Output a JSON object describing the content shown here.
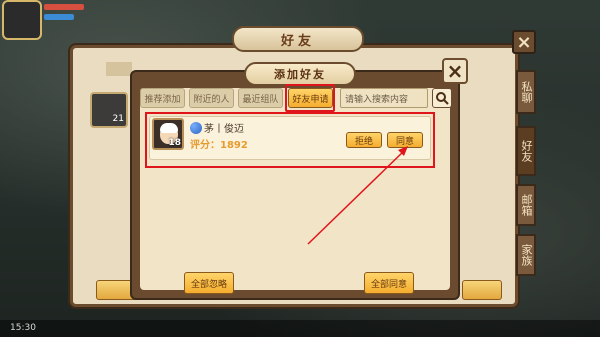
{
  "outer_panel": {
    "title": "好友",
    "side_tabs": [
      "私聊",
      "好友",
      "邮箱",
      "家族"
    ]
  },
  "dialog": {
    "title": "添加好友",
    "tabs": [
      {
        "label": "推荐添加",
        "active": false
      },
      {
        "label": "附近的人",
        "active": false
      },
      {
        "label": "最近组队",
        "active": false
      },
      {
        "label": "好友申请",
        "active": true
      }
    ],
    "search": {
      "placeholder": "请输入搜索内容"
    },
    "request": {
      "name": "茅丨俊迈",
      "level": "18",
      "score_label": "评分：1892",
      "reject_label": "拒绝",
      "accept_label": "同意"
    },
    "ignore_all_label": "全部忽略",
    "accept_all_label": "全部同意"
  },
  "hud": {
    "left_level": "21",
    "clock": "15:30"
  },
  "colors": {
    "highlight_red": "#e0151b",
    "button_gold": "#f4ad2f",
    "panel_brown": "#6b4c2e",
    "parchment": "#f2e4c7"
  }
}
